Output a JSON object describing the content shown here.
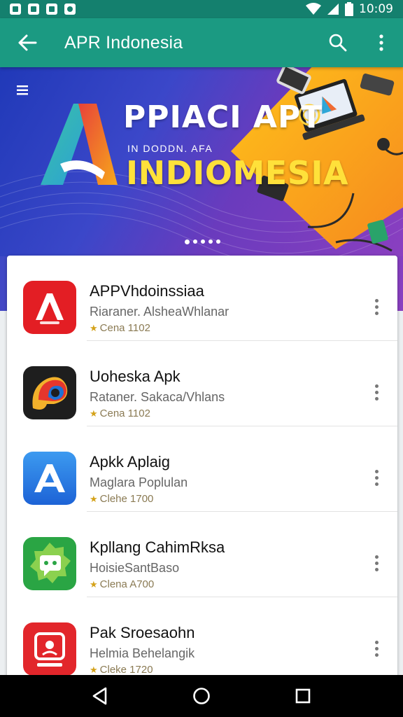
{
  "status_bar": {
    "time": "10:09",
    "icons": [
      "notification-icon",
      "notification-icon",
      "notification-icon",
      "notification-icon",
      "wifi-icon",
      "signal-icon",
      "battery-icon"
    ]
  },
  "app_bar": {
    "title": "APR Indonesia",
    "icons": [
      "arrow-back-icon",
      "search-icon",
      "more-vert-icon"
    ]
  },
  "banner": {
    "headline": "PPIACI APT",
    "subline": "IN DODDN. AFA",
    "word": "INDIOMESIA",
    "slide_count": 5,
    "active_slide": 1
  },
  "apps": [
    {
      "title": "APPVhdoinssiaa",
      "subtitle": "Riaraner. AlsheaWhlanar",
      "rating": "Cena 1102",
      "icon": "red-a-logo-icon"
    },
    {
      "title": "Uoheska Apk",
      "subtitle": "Rataner. Sakaca/Vhlans",
      "rating": "Cena 1102",
      "icon": "colorful-p-logo-icon"
    },
    {
      "title": "Apkk Aplaig",
      "subtitle": "Maglara Poplulan",
      "rating": "Clehe 1700",
      "icon": "blue-a-logo-icon"
    },
    {
      "title": "Kpllang CahimRksa",
      "subtitle": "HoisieSantBaso",
      "rating": "Clena A700",
      "icon": "green-chat-logo-icon"
    },
    {
      "title": "Pak Sroesaohn",
      "subtitle": "Helmia Behelangik",
      "rating": "Cleke 1720",
      "icon": "red-media-logo-icon"
    }
  ],
  "colors": {
    "status_bar": "#14806e",
    "app_bar": "#1b9a82",
    "rating_star": "#d4a21a"
  }
}
